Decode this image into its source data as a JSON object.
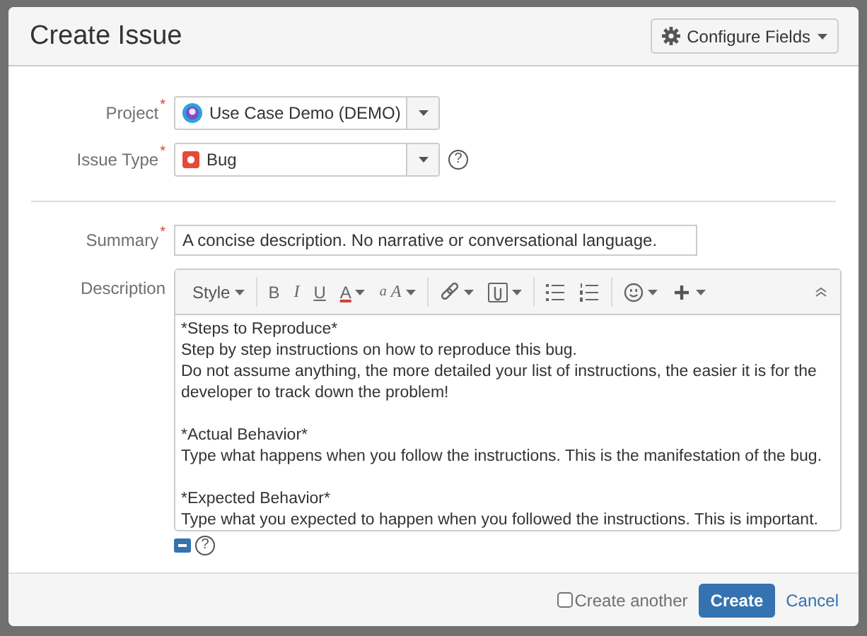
{
  "dialog": {
    "title": "Create Issue",
    "configure_button": "Configure Fields"
  },
  "fields": [
    {
      "kind": "project",
      "label": "Project",
      "required_mark": "*",
      "value": "Use Case Demo (DEMO)"
    },
    {
      "kind": "issue_type",
      "label": "Issue Type",
      "required_mark": "*",
      "value": "Bug",
      "help": "?"
    },
    {
      "kind": "divider"
    },
    {
      "kind": "text",
      "label": "Summary",
      "required_mark": "*",
      "value": "A concise description. No narrative or conversational language."
    }
  ],
  "description": {
    "label": "Description",
    "help": "?",
    "toolbar": [
      [
        {
          "kind": "style",
          "label": "Style",
          "dropdown": true
        }
      ],
      [
        {
          "kind": "bold",
          "label": "B",
          "dropdown": false
        },
        {
          "kind": "italic",
          "label": "I",
          "dropdown": false
        },
        {
          "kind": "underline",
          "label": "U",
          "dropdown": false
        },
        {
          "kind": "color",
          "label": "A",
          "dropdown": true
        },
        {
          "kind": "effects",
          "label": "$^{a}$A",
          "dropdown": true
        }
      ],
      [
        {
          "kind": "link",
          "dropdown": true
        },
        {
          "kind": "attachment",
          "dropdown": true
        }
      ],
      [
        {
          "kind": "bullets",
          "dropdown": false
        },
        {
          "kind": "numbers",
          "dropdown": false
        }
      ],
      [
        {
          "kind": "emoji",
          "dropdown": true
        },
        {
          "kind": "plus",
          "dropdown": true
        }
      ]
    ],
    "paragraphs": [
      {
        "heading": "*Steps to Reproduce*",
        "lines": [
          "Step by step instructions on how to reproduce this bug.",
          "Do not assume anything, the more detailed your list of instructions, the easier it is for the developer to track down the problem!"
        ]
      },
      {
        "heading": "*Actual Behavior*",
        "lines": [
          "Type what happens when you follow the instructions.  This is the manifestation of the bug."
        ]
      },
      {
        "heading": "*Expected Behavior*",
        "lines": [
          "Type what you expected to happen when you followed the instructions.  This is important."
        ]
      }
    ]
  },
  "footer": {
    "create_another": {
      "label": "Create another",
      "checked": false
    },
    "create_button": "Create",
    "cancel_link": "Cancel"
  }
}
